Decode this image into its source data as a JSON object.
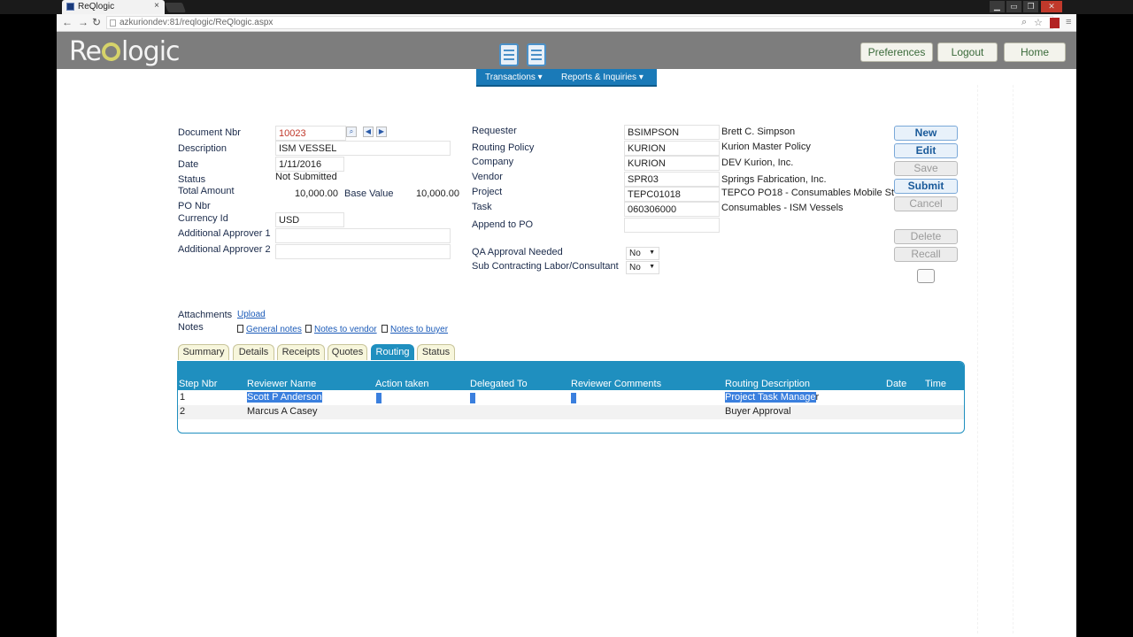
{
  "browser": {
    "tab_title": "ReQlogic",
    "tab_close": "×",
    "url": "azkuriondev:81/reqlogic/ReQlogic.aspx",
    "back": "←",
    "forward": "→",
    "reload": "↻"
  },
  "header": {
    "logo_prefix": "Re",
    "logo_suffix": "logic",
    "preferences": "Preferences",
    "logout": "Logout",
    "home": "Home"
  },
  "menu": {
    "transactions": "Transactions ▾",
    "reports": "Reports & Inquiries ▾"
  },
  "form": {
    "document_nbr_label": "Document Nbr",
    "document_nbr": "10023",
    "description_label": "Description",
    "description": "ISM VESSEL",
    "date_label": "Date",
    "date": "1/11/2016",
    "status_label": "Status",
    "status": "Not Submitted",
    "total_amount_label": "Total Amount",
    "total_amount": "10,000.00",
    "base_value_label": "Base Value",
    "base_value": "10,000.00",
    "po_nbr_label": "PO Nbr",
    "currency_label": "Currency Id",
    "currency": "USD",
    "approver1_label": "Additional Approver 1",
    "approver2_label": "Additional Approver 2",
    "requester_label": "Requester",
    "requester": "BSIMPSON",
    "requester_name": "Brett C. Simpson",
    "routing_policy_label": "Routing Policy",
    "routing_policy": "KURION",
    "routing_policy_name": "Kurion Master Policy",
    "company_label": "Company",
    "company": "KURION",
    "company_name": "DEV Kurion, Inc.",
    "vendor_label": "Vendor",
    "vendor": "SPR03",
    "vendor_name": "Springs Fabrication, Inc.",
    "project_label": "Project",
    "project": "TEPC01018",
    "project_name": "TEPCO PO18 - Consumables Mobile St",
    "task_label": "Task",
    "task": "060306000",
    "task_name": "Consumables - ISM Vessels",
    "append_po_label": "Append to PO",
    "qa_label": "QA Approval Needed",
    "qa_value": "No",
    "subcontract_label": "Sub Contracting Labor/Consultant",
    "subcontract_value": "No"
  },
  "actions": {
    "new": "New",
    "edit": "Edit",
    "save": "Save",
    "submit": "Submit",
    "cancel": "Cancel",
    "delete": "Delete",
    "recall": "Recall"
  },
  "attachments": {
    "label": "Attachments",
    "upload": "Upload",
    "notes_label": "Notes",
    "general": "General notes",
    "vendor": "Notes to vendor",
    "buyer": "Notes to buyer"
  },
  "tabs": [
    "Summary",
    "Details",
    "Receipts",
    "Quotes",
    "Routing",
    "Status"
  ],
  "routing": {
    "columns": [
      "Step Nbr",
      "Reviewer Name",
      "Action taken",
      "Delegated To",
      "Reviewer Comments",
      "Routing Description",
      "Date",
      "Time"
    ],
    "rows": [
      {
        "step": "1",
        "reviewer": "Scott P Anderson",
        "description_sel": "Project Task Manage",
        "description_rest": "r"
      },
      {
        "step": "2",
        "reviewer": "Marcus A Casey",
        "description": "Buyer Approval"
      }
    ]
  }
}
